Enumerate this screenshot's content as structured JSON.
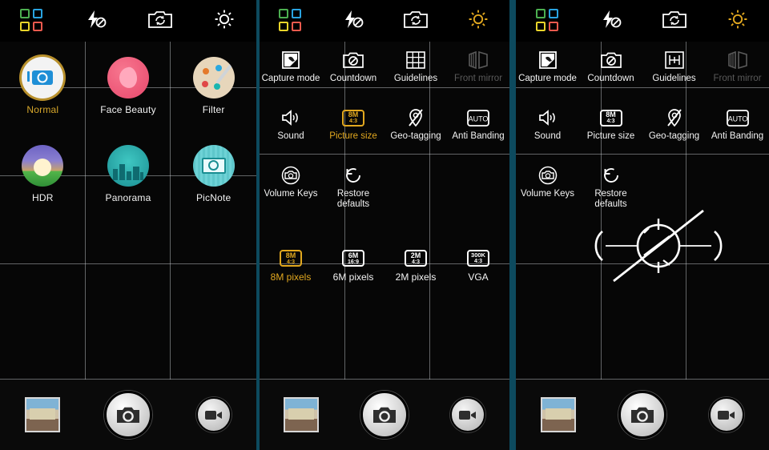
{
  "app": {
    "title": "Camera",
    "accent": "#e2a81f",
    "dim": "#5a5a5a",
    "separator": "#0d4a5e"
  },
  "topbar": {
    "modes_icon": "modes-grid-icon",
    "flash_icon": "flash-off-icon",
    "switch_icon": "switch-camera-icon",
    "settings_icon": "settings-gear-icon"
  },
  "panel1": {
    "modes": [
      {
        "label": "Normal",
        "icon": "mode-normal-icon",
        "selected": true
      },
      {
        "label": "Face Beauty",
        "icon": "mode-face-beauty-icon",
        "selected": false
      },
      {
        "label": "Filter",
        "icon": "mode-filter-icon",
        "selected": false
      },
      {
        "label": "HDR",
        "icon": "mode-hdr-icon",
        "selected": false
      },
      {
        "label": "Panorama",
        "icon": "mode-panorama-icon",
        "selected": false
      },
      {
        "label": "PicNote",
        "icon": "mode-picnote-icon",
        "selected": false
      }
    ]
  },
  "panel2": {
    "settings": [
      {
        "label": "Capture mode",
        "icon": "capture-mode-icon",
        "state": "normal"
      },
      {
        "label": "Countdown",
        "icon": "countdown-icon",
        "state": "normal"
      },
      {
        "label": "Guidelines",
        "icon": "guidelines-grid-icon",
        "state": "normal"
      },
      {
        "label": "Front mirror",
        "icon": "front-mirror-icon",
        "state": "disabled"
      },
      {
        "label": "Sound",
        "icon": "sound-icon",
        "state": "normal"
      },
      {
        "label": "Picture size",
        "icon": "picture-size-icon",
        "state": "selected",
        "chip_a": "8M",
        "chip_b": "4:3"
      },
      {
        "label": "Geo-tagging",
        "icon": "geo-tagging-off-icon",
        "state": "normal"
      },
      {
        "label": "Anti Banding",
        "icon": "anti-banding-auto-icon",
        "state": "normal"
      },
      {
        "label": "Volume Keys",
        "icon": "volume-keys-icon",
        "state": "normal"
      },
      {
        "label": "Restore defaults",
        "icon": "restore-defaults-icon",
        "state": "normal"
      }
    ],
    "picture_sizes": [
      {
        "label": "8M pixels",
        "chip_a": "8M",
        "chip_b": "4:3",
        "selected": true
      },
      {
        "label": "6M pixels",
        "chip_a": "6M",
        "chip_b": "16:9",
        "selected": false
      },
      {
        "label": "2M pixels",
        "chip_a": "2M",
        "chip_b": "4:3",
        "selected": false
      },
      {
        "label": "VGA",
        "chip_a": "300K",
        "chip_b": "4:3",
        "selected": false
      }
    ]
  },
  "panel3": {
    "settings": [
      {
        "label": "Capture mode",
        "icon": "capture-mode-icon",
        "state": "normal"
      },
      {
        "label": "Countdown",
        "icon": "countdown-icon",
        "state": "normal"
      },
      {
        "label": "Guidelines",
        "icon": "guidelines-center-icon",
        "state": "normal"
      },
      {
        "label": "Front mirror",
        "icon": "front-mirror-icon",
        "state": "disabled"
      },
      {
        "label": "Sound",
        "icon": "sound-icon",
        "state": "normal"
      },
      {
        "label": "Picture size",
        "icon": "picture-size-icon",
        "state": "normal",
        "chip_a": "8M",
        "chip_b": "4:3"
      },
      {
        "label": "Geo-tagging",
        "icon": "geo-tagging-off-icon",
        "state": "normal"
      },
      {
        "label": "Anti Banding",
        "icon": "anti-banding-auto-icon",
        "state": "normal"
      },
      {
        "label": "Volume Keys",
        "icon": "volume-keys-icon",
        "state": "normal"
      },
      {
        "label": "Restore defaults",
        "icon": "restore-defaults-icon",
        "state": "normal"
      }
    ],
    "gesture_overlay": "swipe-gesture-indicator"
  },
  "bottombar": {
    "thumbnail": "last-photo-thumbnail",
    "shutter": "shutter-button",
    "video": "video-record-button"
  }
}
